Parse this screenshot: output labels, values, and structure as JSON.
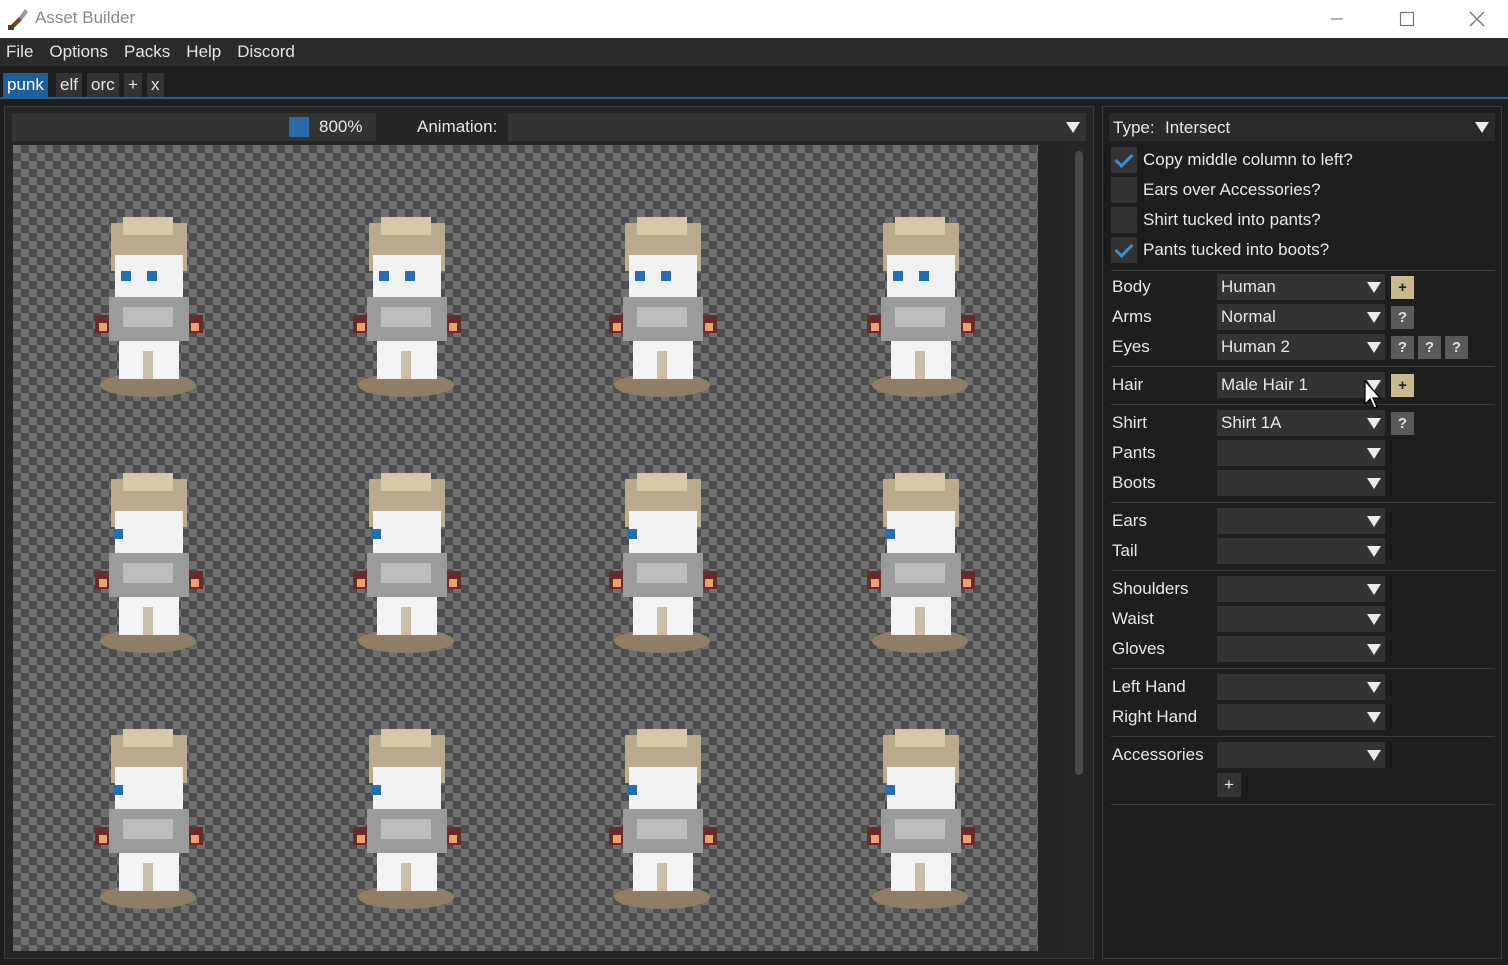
{
  "window": {
    "title": "Asset Builder"
  },
  "menu": [
    "File",
    "Options",
    "Packs",
    "Help",
    "Discord"
  ],
  "tabs": [
    "punk",
    "elf",
    "orc",
    "+",
    "x"
  ],
  "preview": {
    "zoom": "800%",
    "zoom_swatch_color": "#2f6aa6",
    "animation_label": "Animation:",
    "animation_value": ""
  },
  "settings": {
    "type_label": "Type:",
    "type_value": "Intersect",
    "options": [
      {
        "label": "Copy middle column to left?",
        "checked": true
      },
      {
        "label": "Ears over Accessories?",
        "checked": false
      },
      {
        "label": "Shirt tucked into pants?",
        "checked": false
      },
      {
        "label": "Pants tucked into boots?",
        "checked": true
      }
    ]
  },
  "slots": {
    "body": {
      "label": "Body",
      "value": "Human",
      "buttons": [
        "+"
      ]
    },
    "arms": {
      "label": "Arms",
      "value": "Normal",
      "buttons": [
        "?"
      ]
    },
    "eyes": {
      "label": "Eyes",
      "value": "Human 2",
      "buttons": [
        "?",
        "?",
        "?"
      ]
    },
    "hair": {
      "label": "Hair",
      "value": "Male Hair 1",
      "buttons": [
        "+"
      ]
    },
    "shirt": {
      "label": "Shirt",
      "value": "Shirt 1A",
      "buttons": [
        "?"
      ]
    },
    "pants": {
      "label": "Pants",
      "value": ""
    },
    "boots": {
      "label": "Boots",
      "value": ""
    },
    "ears": {
      "label": "Ears",
      "value": ""
    },
    "tail": {
      "label": "Tail",
      "value": ""
    },
    "shoulders": {
      "label": "Shoulders",
      "value": ""
    },
    "waist": {
      "label": "Waist",
      "value": ""
    },
    "gloves": {
      "label": "Gloves",
      "value": ""
    },
    "left_hand": {
      "label": "Left Hand",
      "value": ""
    },
    "right_hand": {
      "label": "Right Hand",
      "value": ""
    },
    "accessories": {
      "label": "Accessories",
      "value": "",
      "add_label": "+"
    }
  },
  "colors": {
    "accent": "#1f5f9a",
    "checkmark": "#3a8fd6",
    "plus_button": "#cbb98f"
  }
}
